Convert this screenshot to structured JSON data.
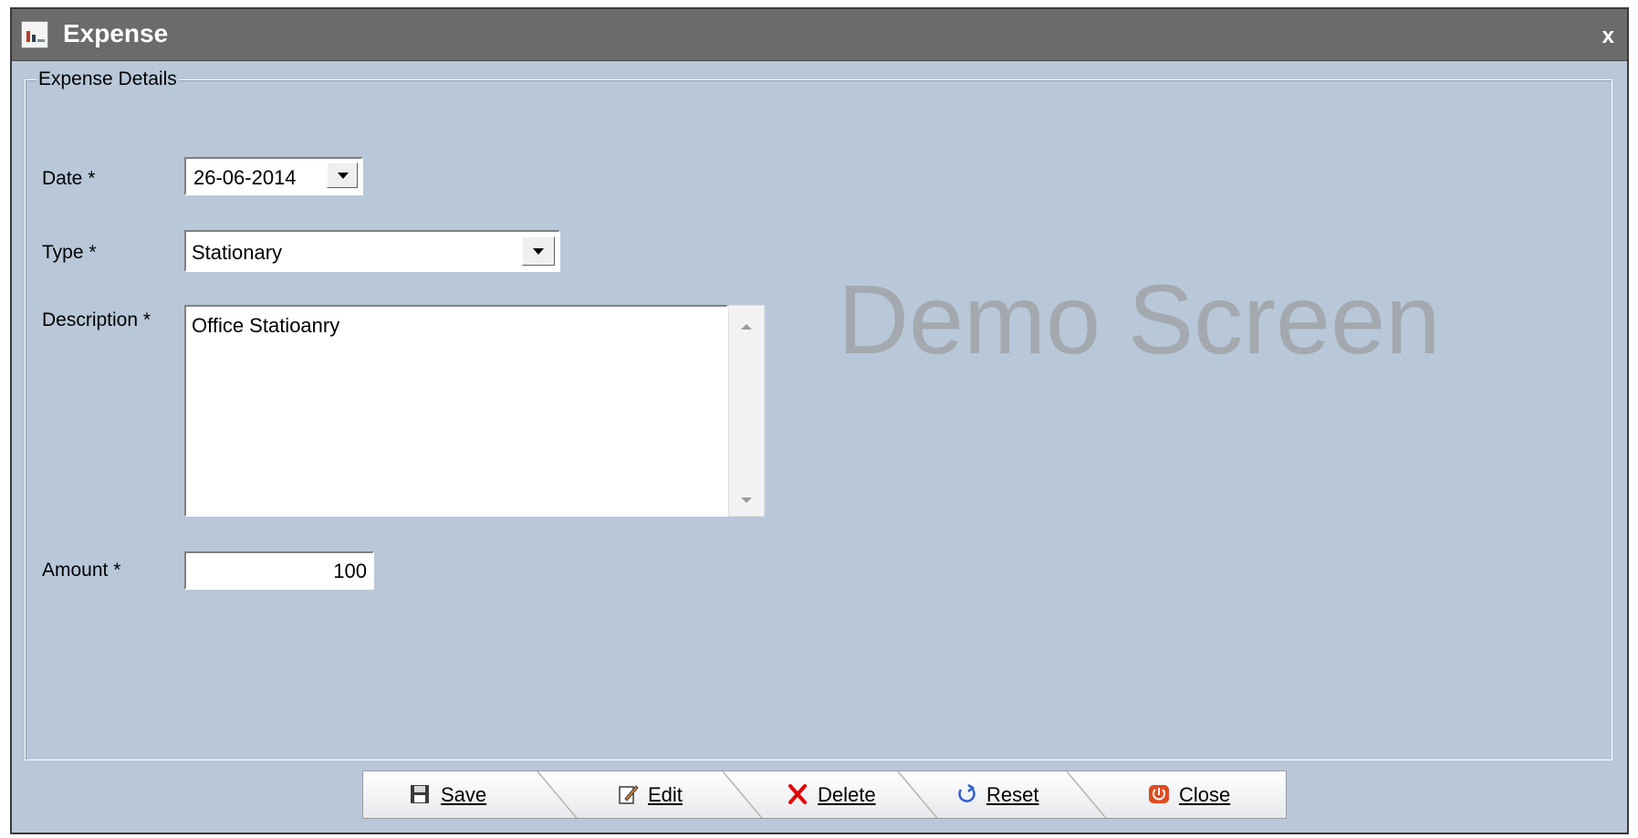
{
  "window": {
    "title": "Expense",
    "close_label": "x"
  },
  "group": {
    "legend": "Expense Details"
  },
  "form": {
    "date": {
      "label": "Date *",
      "value": "26-06-2014"
    },
    "type": {
      "label": "Type *",
      "value": "Stationary"
    },
    "description": {
      "label": "Description *",
      "value": "Office Statioanry"
    },
    "amount": {
      "label": "Amount *",
      "value": "100"
    }
  },
  "watermark": "Demo Screen",
  "toolbar": {
    "save": "Save",
    "edit": "Edit",
    "delete": "Delete",
    "reset": "Reset",
    "close": "Close"
  },
  "icons": {
    "app": "chart-app-icon",
    "save": "floppy-disk-icon",
    "edit": "pencil-note-icon",
    "delete": "red-x-icon",
    "reset": "circular-arrow-icon",
    "close": "power-icon"
  }
}
